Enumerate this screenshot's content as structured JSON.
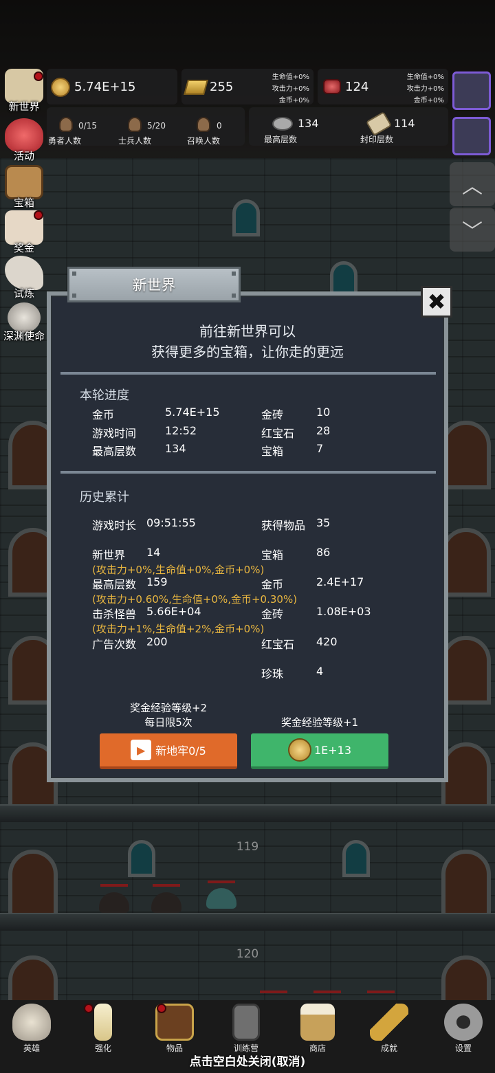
{
  "top": {
    "gold": "5.74E+15",
    "bricks": "255",
    "bricks_bonus": [
      "生命值+0%",
      "攻击力+0%",
      "金币+0%"
    ],
    "rubies": "124",
    "rubies_bonus": [
      "生命值+0%",
      "攻击力+0%",
      "金币+0%"
    ],
    "heroes": {
      "value": "0/15",
      "label": "勇者人数"
    },
    "soldiers": {
      "value": "5/20",
      "label": "士兵人数"
    },
    "summons": {
      "value": "0",
      "label": "召唤人数"
    },
    "max_floor": {
      "value": "134",
      "label": "最高层数"
    },
    "sealed_floor": {
      "value": "114",
      "label": "封印层数"
    }
  },
  "side_menu": [
    "新世界",
    "活动",
    "宝箱",
    "奖金",
    "试炼",
    "深渊使命"
  ],
  "scene": {
    "floor_1": "119",
    "floor_2": "120"
  },
  "dialog": {
    "title": "新世界",
    "desc_1": "前往新世界可以",
    "desc_2": "获得更多的宝箱，让你走的更远",
    "round_title": "本轮进度",
    "round": [
      {
        "k": "金币",
        "v": "5.74E+15",
        "k2": "金砖",
        "v2": "10"
      },
      {
        "k": "游戏时间",
        "v": "12:52",
        "k2": "红宝石",
        "v2": "28"
      },
      {
        "k": "最高层数",
        "v": "134",
        "k2": "宝箱",
        "v2": "7"
      }
    ],
    "history_title": "历史累计",
    "history": {
      "play_time_k": "游戏时长",
      "play_time_v": "09:51:55",
      "items_k": "获得物品",
      "items_v": "35",
      "new_world_k": "新世界",
      "new_world_v": "14",
      "chest_k": "宝箱",
      "chest_v": "86",
      "new_world_bonus": "(攻击力+0%,生命值+0%,金币+0%)",
      "max_floor_k": "最高层数",
      "max_floor_v": "159",
      "gold_k": "金币",
      "gold_v": "2.4E+17",
      "max_floor_bonus": "(攻击力+0.60%,生命值+0%,金币+0.30%)",
      "kills_k": "击杀怪兽",
      "kills_v": "5.66E+04",
      "bricks_k": "金砖",
      "bricks_v": "1.08E+03",
      "kills_bonus": "(攻击力+1%,生命值+2%,金币+0%)",
      "ads_k": "广告次数",
      "ads_v": "200",
      "ruby_k": "红宝石",
      "ruby_v": "420",
      "pearl_k": "珍珠",
      "pearl_v": "4"
    },
    "btn_left_caption_1": "奖金经验等级+2",
    "btn_left_caption_2": "每日限5次",
    "btn_left_label": "新地牢0/5",
    "btn_right_caption": "奖金经验等级+1",
    "btn_right_label": "1E+13"
  },
  "bottom_nav": [
    "英雄",
    "强化",
    "物品",
    "训练营",
    "商店",
    "成就",
    "设置"
  ],
  "close_hint": "点击空白处关闭(取消)",
  "colors": {
    "accent_orange": "#e06a2a",
    "accent_green": "#3fb56b",
    "bonus_text": "#e8b640"
  }
}
